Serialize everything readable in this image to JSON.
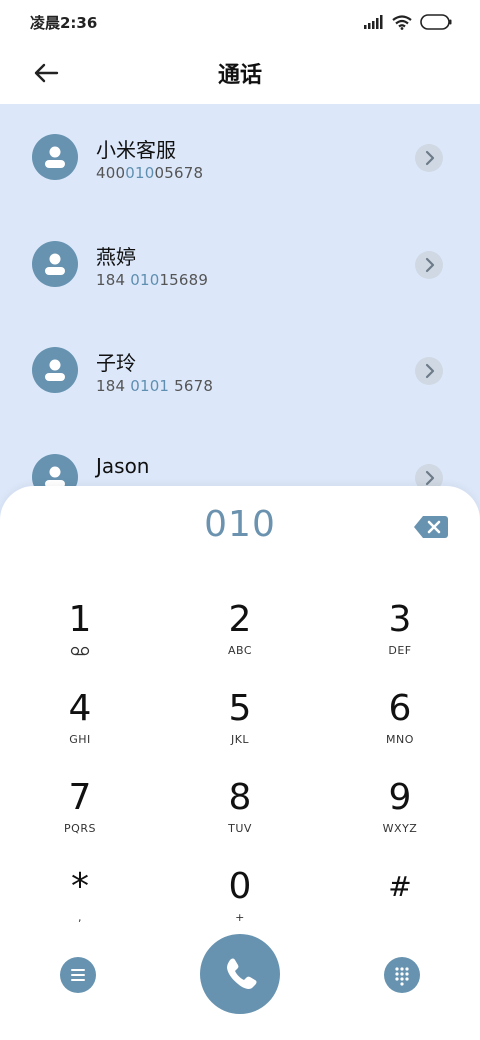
{
  "status_bar": {
    "time": "凌晨2:36"
  },
  "header": {
    "title": "通话"
  },
  "results": [
    {
      "name": "小米客服",
      "number_parts": [
        "400",
        "010",
        "05678"
      ]
    },
    {
      "name": "燕婷",
      "number_parts": [
        "184 ",
        "010",
        "15689"
      ]
    },
    {
      "name": "子玲",
      "number_parts": [
        "184 ",
        "0101",
        " 5678"
      ]
    },
    {
      "name": "Jason",
      "number_parts": [
        "",
        "",
        ""
      ]
    }
  ],
  "dialer": {
    "input": "010",
    "keys": [
      {
        "num": "1",
        "sub": ""
      },
      {
        "num": "2",
        "sub": "ABC"
      },
      {
        "num": "3",
        "sub": "DEF"
      },
      {
        "num": "4",
        "sub": "GHI"
      },
      {
        "num": "5",
        "sub": "JKL"
      },
      {
        "num": "6",
        "sub": "MNO"
      },
      {
        "num": "7",
        "sub": "PQRS"
      },
      {
        "num": "8",
        "sub": "TUV"
      },
      {
        "num": "9",
        "sub": "WXYZ"
      },
      {
        "num": "*",
        "sub": ","
      },
      {
        "num": "0",
        "sub": "+"
      },
      {
        "num": "#",
        "sub": ""
      }
    ]
  },
  "icons": {
    "back": "arrow-left-icon",
    "delete": "backspace-icon",
    "voicemail": "voicemail-icon",
    "menu": "menu-icon",
    "call": "phone-icon",
    "keypad": "dialpad-icon",
    "chevron": "chevron-right-icon",
    "avatar": "person-icon"
  },
  "colors": {
    "accent": "#6793b0",
    "results_bg": "#dce8fa",
    "highlight": "#5f8fb0"
  }
}
